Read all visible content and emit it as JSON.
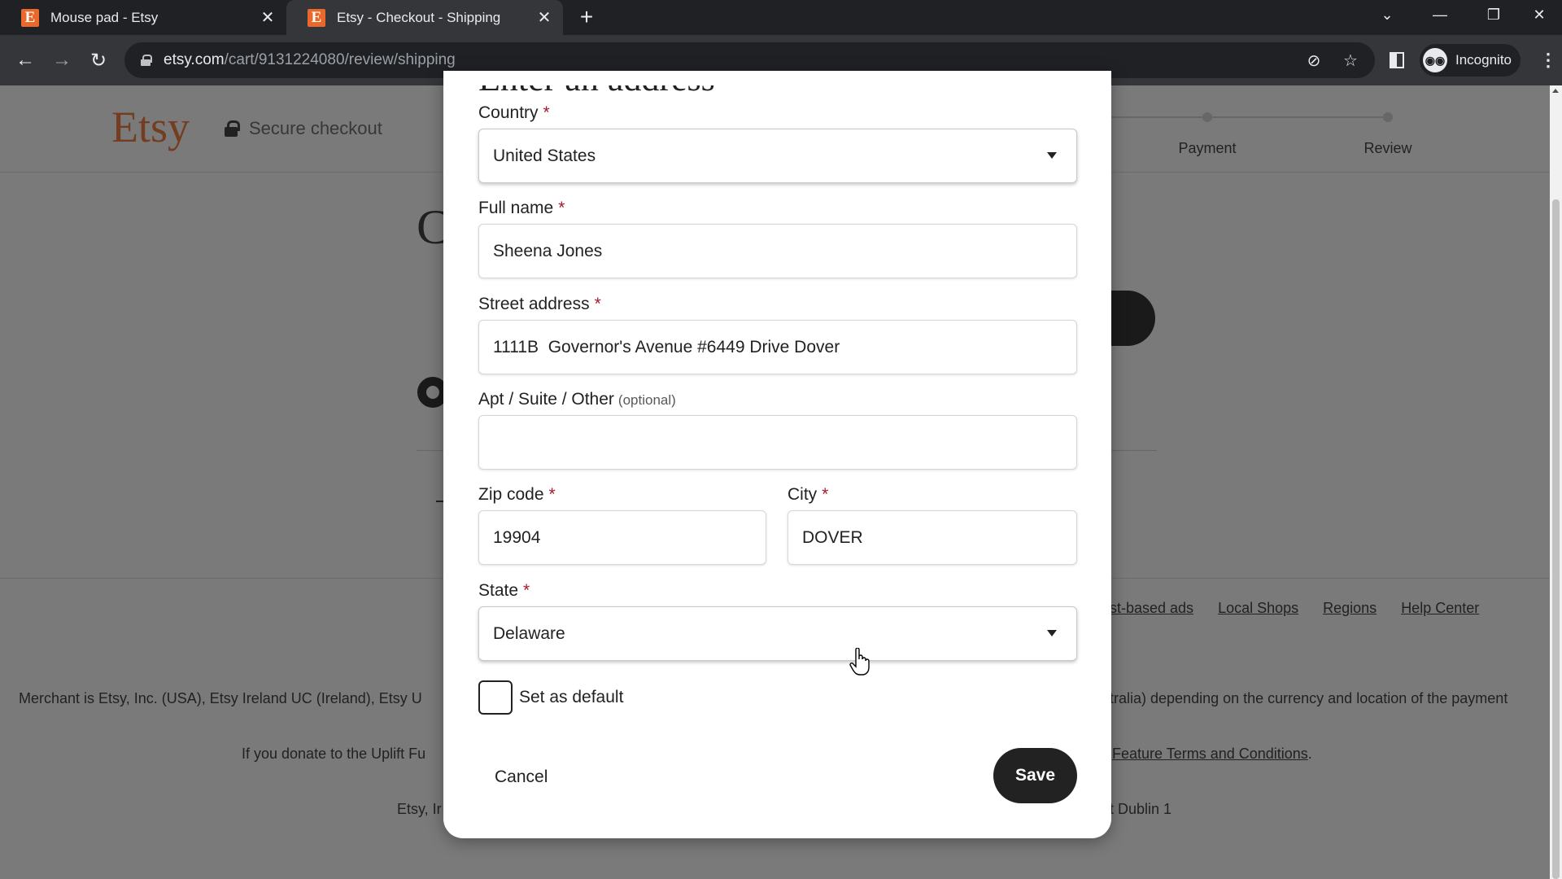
{
  "browser": {
    "tabs": [
      {
        "title": "Mouse pad - Etsy",
        "favicon": "E",
        "active": false
      },
      {
        "title": "Etsy - Checkout - Shipping",
        "favicon": "E",
        "active": true
      }
    ],
    "url_host": "etsy.com",
    "url_path": "/cart/9131224080/review/shipping",
    "profile_label": "Incognito",
    "icons": {
      "new_tab": "+",
      "tab_close": "✕",
      "back": "←",
      "forward": "→",
      "reload": "↻",
      "eye_off": "⊘",
      "star": "☆",
      "minimize": "—",
      "restore": "❐",
      "close": "✕",
      "tab_search": "⌄",
      "menu": "⋮"
    }
  },
  "page": {
    "logo": "Etsy",
    "secure_checkout": "Secure checkout",
    "steps": [
      "Payment",
      "Review"
    ],
    "bg_heading_fragment": "C",
    "footer_links": [
      "st-based ads",
      "Local Shops",
      "Regions",
      "Help Center"
    ],
    "footer_merchant_left": "Merchant is Etsy, Inc. (USA), Etsy Ireland UC (Ireland), Etsy U",
    "footer_merchant_right": "tralia) depending on the currency and location of the payment",
    "footer_donate_left": "If you donate to the Uplift Fu",
    "footer_donate_right_link": "Feature Terms and Conditions",
    "footer_donate_right_end": ".",
    "footer_address_left": "Etsy, Ir",
    "footer_address_right": "t Dublin 1"
  },
  "modal": {
    "title": "Enter an address",
    "required_marker": "*",
    "fields": {
      "country": {
        "label": "Country",
        "value": "United States"
      },
      "full_name": {
        "label": "Full name",
        "value": "Sheena Jones"
      },
      "street": {
        "label": "Street address",
        "value": "1111B  Governor's Avenue #6449 Drive Dover"
      },
      "apt": {
        "label": "Apt / Suite / Other",
        "optional": "(optional)",
        "value": ""
      },
      "zip": {
        "label": "Zip code",
        "value": "19904"
      },
      "city": {
        "label": "City",
        "value": "DOVER"
      },
      "state": {
        "label": "State",
        "value": "Delaware"
      }
    },
    "set_default": {
      "label": "Set as default",
      "checked": false
    },
    "cancel_label": "Cancel",
    "save_label": "Save"
  }
}
